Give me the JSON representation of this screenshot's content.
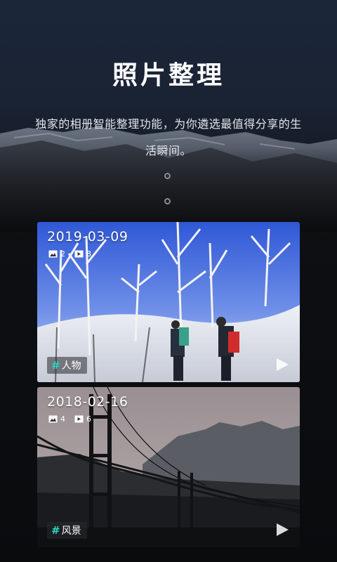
{
  "header": {
    "title": "照片整理",
    "subtitle": "独家的相册智能整理功能，为你遴选最值得分享的生活瞬间。"
  },
  "albums": [
    {
      "date": "2019-03-09",
      "photo_count": "2",
      "video_count": "8",
      "tag_symbol": "#",
      "tag": "人物"
    },
    {
      "date": "2018-02-16",
      "photo_count": "4",
      "video_count": "6",
      "tag_symbol": "#",
      "tag": "风景"
    }
  ],
  "colors": {
    "tag_hash": "#2ed3c4",
    "text": "#ffffff"
  },
  "icons": {
    "photo": "image-icon",
    "video": "video-icon",
    "play": "play-icon"
  }
}
